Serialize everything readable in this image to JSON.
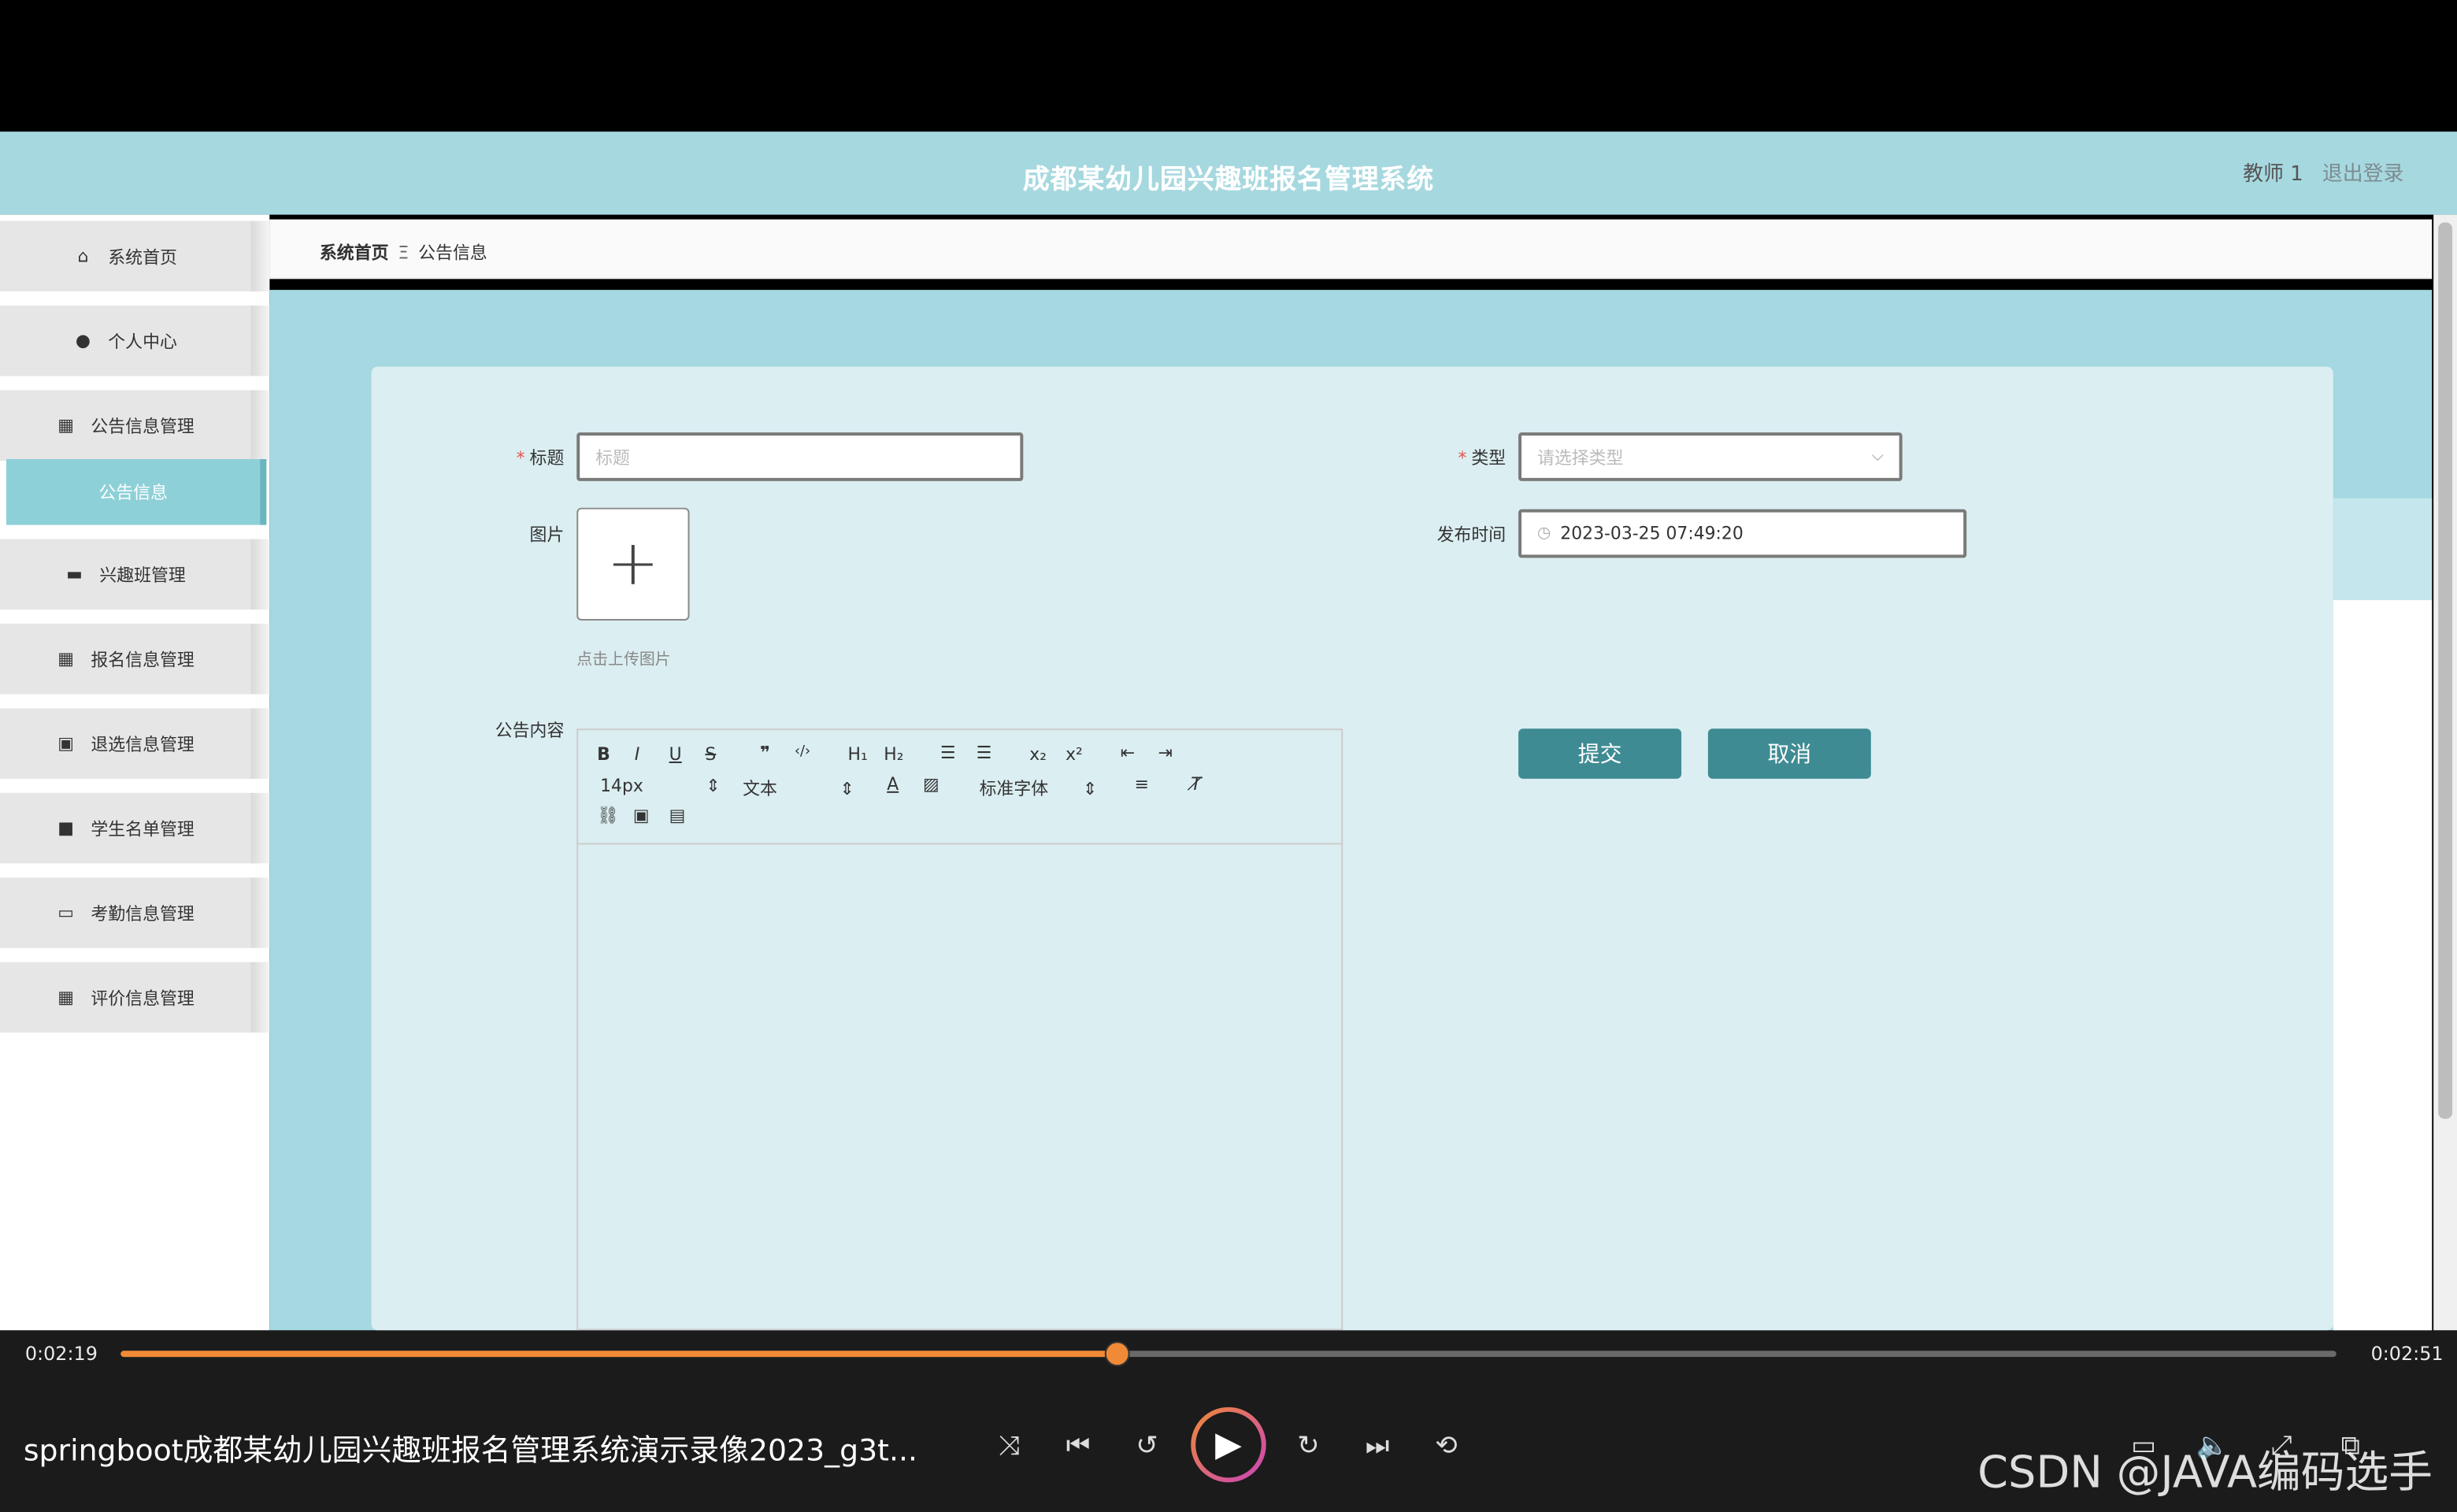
{
  "app": {
    "title": "成都某幼儿园兴趣班报名管理系统",
    "user": "教师 1",
    "logout": "退出登录"
  },
  "sidebar": {
    "items": [
      {
        "label": "系统首页",
        "icon": "home-icon"
      },
      {
        "label": "个人中心",
        "icon": "user-icon"
      },
      {
        "label": "公告信息管理",
        "icon": "grid-icon"
      },
      {
        "label": "兴趣班管理",
        "icon": "easel-icon"
      },
      {
        "label": "报名信息管理",
        "icon": "grid-icon"
      },
      {
        "label": "退选信息管理",
        "icon": "clipboard-icon"
      },
      {
        "label": "学生名单管理",
        "icon": "video-icon"
      },
      {
        "label": "考勤信息管理",
        "icon": "monitor-icon"
      },
      {
        "label": "评价信息管理",
        "icon": "grid-icon"
      }
    ],
    "sub_item": "公告信息"
  },
  "breadcrumb": {
    "home": "系统首页",
    "sep": "Ξ",
    "current": "公告信息"
  },
  "form": {
    "title_label": "标题",
    "title_placeholder": "标题",
    "type_label": "类型",
    "type_placeholder": "请选择类型",
    "image_label": "图片",
    "upload_hint": "点击上传图片",
    "publish_label": "发布时间",
    "publish_value": "2023-03-25 07:49:20",
    "content_label": "公告内容",
    "submit": "提交",
    "cancel": "取消"
  },
  "editor": {
    "font_size": "14px",
    "paragraph": "文本",
    "font_family": "标准字体"
  },
  "player": {
    "current_time": "0:02:19",
    "total_time": "0:02:51",
    "progress": 0.45,
    "video_title": "springboot成都某幼儿园兴趣班报名管理系统演示录像2023_g3t...",
    "watermark": "CSDN @JAVA编码选手",
    "accent": "#f08a36"
  }
}
